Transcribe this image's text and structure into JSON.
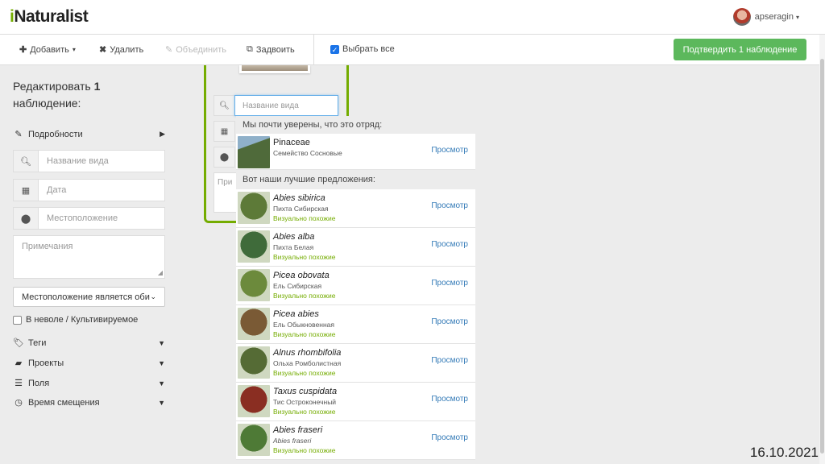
{
  "app": {
    "logo_i": "i",
    "logo_rest": "Naturalist",
    "username": "apseragin"
  },
  "toolbar": {
    "add_label": "Добавить",
    "delete_label": "Удалить",
    "merge_label": "Объединить",
    "duplicate_label": "Задвоить",
    "select_all_label": "Выбрать все",
    "confirm_label": "Подтвердить 1 наблюдение"
  },
  "left_panel": {
    "title_prefix": "Редактировать ",
    "title_count": "1",
    "title_suffix": "наблюдение:",
    "details_label": "Подробности",
    "species_placeholder": "Название вида",
    "date_placeholder": "Дата",
    "location_placeholder": "Местоположение",
    "notes_placeholder": "Примечания",
    "geoprivacy_value": "Местоположение является оби",
    "captive_label": "В неволе / Культивируемое",
    "tags_label": "Теги",
    "projects_label": "Проекты",
    "fields_label": "Поля",
    "time_offset_label": "Время смещения"
  },
  "observation_card": {
    "species_placeholder": "Название вида",
    "notes_placeholder": "При"
  },
  "suggestions": {
    "confident_heading": "Мы почти уверены, что это отряд:",
    "confident": {
      "name": "Pinaceae",
      "common": "Семейство Сосновые",
      "view": "Просмотр",
      "image_color": "#4f6a3a"
    },
    "top_heading": "Вот наши лучшие предложения:",
    "items": [
      {
        "name": "Abies sibirica",
        "common": "Пихта Сибирская",
        "visual": "Визуально похожие",
        "view": "Просмотр",
        "image_color": "#5d7a38"
      },
      {
        "name": "Abies alba",
        "common": "Пихта Белая",
        "visual": "Визуально похожие",
        "view": "Просмотр",
        "image_color": "#3f6b3a"
      },
      {
        "name": "Picea obovata",
        "common": "Ель Сибирская",
        "visual": "Визуально похожие",
        "view": "Просмотр",
        "image_color": "#6c8a3c"
      },
      {
        "name": "Picea abies",
        "common": "Ель Обыкновенная",
        "visual": "Визуально похожие",
        "view": "Просмотр",
        "image_color": "#7a5a35"
      },
      {
        "name": "Alnus rhombifolia",
        "common": "Ольха Ромболистная",
        "visual": "Визуально похожие",
        "view": "Просмотр",
        "image_color": "#556b35"
      },
      {
        "name": "Taxus cuspidata",
        "common": "Тис Остроконечный",
        "visual": "Визуально похожие",
        "view": "Просмотр",
        "image_color": "#8a2e22"
      },
      {
        "name": "Abies fraseri",
        "common": "Abies fraseri",
        "visual": "Визуально похожие",
        "view": "Просмотр",
        "image_color": "#4e7a36"
      }
    ]
  },
  "date_stamp": "16.10.2021"
}
